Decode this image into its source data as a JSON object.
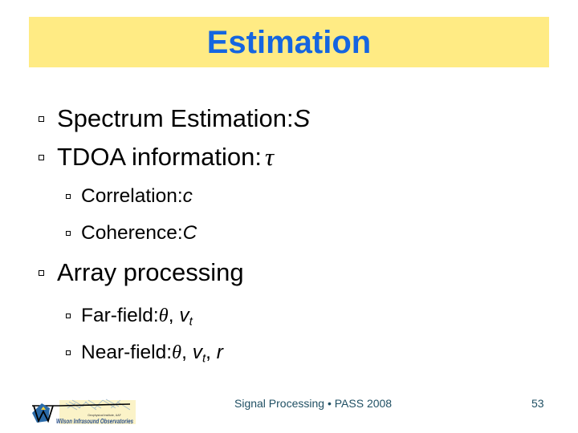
{
  "slide": {
    "title": "Estimation",
    "bullets": [
      {
        "text": "Spectrum Estimation: ",
        "var": "S"
      },
      {
        "text": "TDOA information: ",
        "var": "τ"
      }
    ],
    "tdoa_sub": [
      {
        "text": "Correlation: ",
        "var": "c"
      },
      {
        "text": "Coherence: ",
        "var": "C"
      }
    ],
    "array": {
      "text": "Array processing",
      "sub": [
        {
          "text": "Far-field: ",
          "theta": "θ",
          "sep": ", ",
          "v": "v",
          "v_sub": "t"
        },
        {
          "text": "Near-field: ",
          "theta": "θ",
          "sep": ", ",
          "v": "v",
          "v_sub": "t",
          "sep2": ", ",
          "r": "r"
        }
      ]
    }
  },
  "footer": {
    "text": "Signal Processing • PASS 2008",
    "page_number": "53",
    "logo_caption": "Wilson Infrasound Observatories",
    "logo_subcaption": "Geophysical Institute, UAF"
  },
  "colors": {
    "title_bg": "#ffeb84",
    "title_text": "#1565e0",
    "footer_text": "#1f4f63"
  }
}
